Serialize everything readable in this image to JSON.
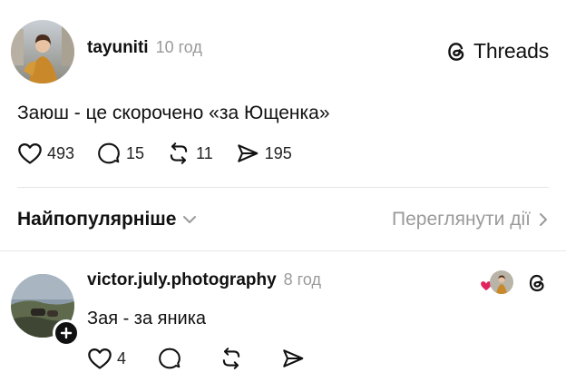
{
  "post": {
    "username": "tayuniti",
    "time": "10 год",
    "brand": "Threads",
    "text": "Заюш - це скорочено «за Ющенка»",
    "likes": "493",
    "comments": "15",
    "reposts": "11",
    "shares": "195"
  },
  "sort": {
    "label": "Найпопулярніше",
    "view_activity": "Переглянути дії"
  },
  "reply": {
    "username": "victor.july.photography",
    "time": "8 год",
    "text": "Зая - за яника",
    "likes": "4"
  },
  "colors": {
    "muted": "#9a9a9a",
    "heart_red": "#e0245e",
    "divider": "#e6e6e6"
  }
}
